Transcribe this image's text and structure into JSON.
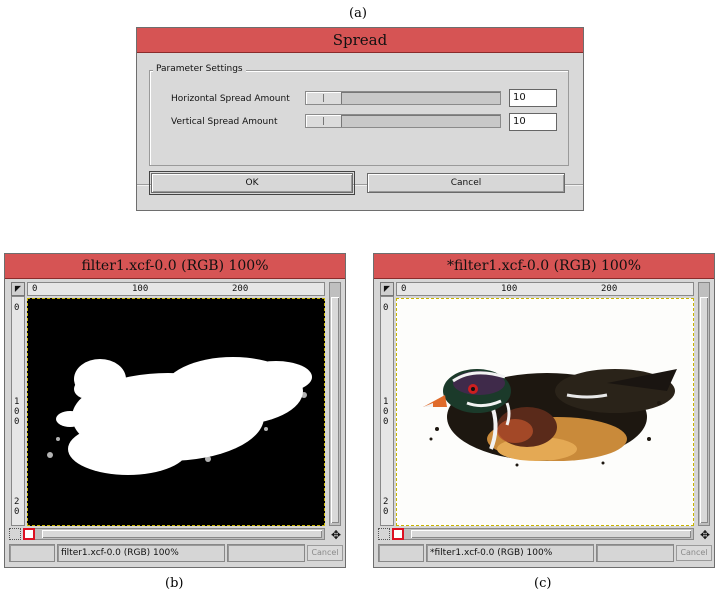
{
  "captions": {
    "a": "(a)",
    "b": "(b)",
    "c": "(c)"
  },
  "dialog": {
    "title": "Spread",
    "group_label": "Parameter Settings",
    "rows": [
      {
        "label": "Horizontal Spread Amount",
        "value": "10"
      },
      {
        "label": "Vertical Spread Amount",
        "value": "10"
      }
    ],
    "ok_label": "OK",
    "cancel_label": "Cancel"
  },
  "windows": [
    {
      "title": "filter1.xcf-0.0 (RGB) 100%",
      "status": "filter1.xcf-0.0 (RGB) 100%",
      "cancel_label": "Cancel",
      "ruler_ticks_h": [
        "0",
        "100",
        "200"
      ],
      "ruler_ticks_v": [
        "0",
        "1 0 0",
        "2 0"
      ],
      "content": "white-mask-on-black"
    },
    {
      "title": "*filter1.xcf-0.0 (RGB) 100%",
      "status": "*filter1.xcf-0.0 (RGB) 100%",
      "cancel_label": "Cancel",
      "ruler_ticks_h": [
        "0",
        "100",
        "200"
      ],
      "ruler_ticks_v": [
        "0",
        "1 0 0",
        "2 0"
      ],
      "content": "spread-duck-on-white"
    }
  ],
  "colors": {
    "titlebar": "#d65454",
    "window_bg": "#d9d9d9",
    "mask_bg": "#000000",
    "mask_fg": "#ffffff"
  }
}
